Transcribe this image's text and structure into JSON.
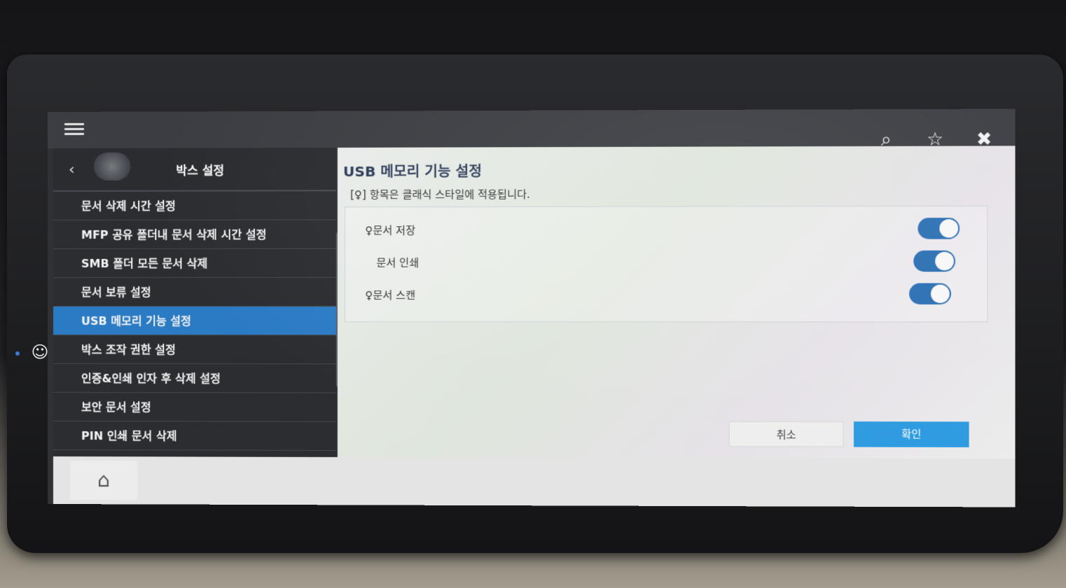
{
  "sidebar": {
    "title": "박스 설정",
    "back_icon": "chevron-left-icon",
    "items": [
      {
        "label": "문서 삭제 시간 설정"
      },
      {
        "label": "MFP 공유 폴더내 문서 삭제 시간 설정"
      },
      {
        "label": "SMB 폴더 모든 문서 삭제"
      },
      {
        "label": "문서 보류 설정"
      },
      {
        "label": "USB 메모리 기능 설정",
        "active": true
      },
      {
        "label": "박스 조작 권한 설정"
      },
      {
        "label": "인증&인쇄 인자 후 삭제 설정"
      },
      {
        "label": "보안 문서 설정"
      },
      {
        "label": "PIN 인쇄 문서 삭제"
      }
    ]
  },
  "topbar": {
    "icons": [
      "menu-icon",
      "search-icon",
      "star-icon",
      "close-icon"
    ]
  },
  "content": {
    "title": "USB 메모리 기능 설정",
    "note": "[♀] 항목은 클래식 스타일에 적용됩니다.",
    "options": [
      {
        "label": "♀문서 저장",
        "enabled": true
      },
      {
        "label": "문서 인쇄",
        "enabled": true
      },
      {
        "label": "♀문서 스캔",
        "enabled": true
      }
    ],
    "cancel_label": "취소",
    "ok_label": "확인"
  },
  "footer": {
    "home_icon": "home-icon"
  },
  "colors": {
    "accent": "#2b7bc4",
    "ok_button": "#2f9be0",
    "toggle_on": "#2b6fb3"
  }
}
